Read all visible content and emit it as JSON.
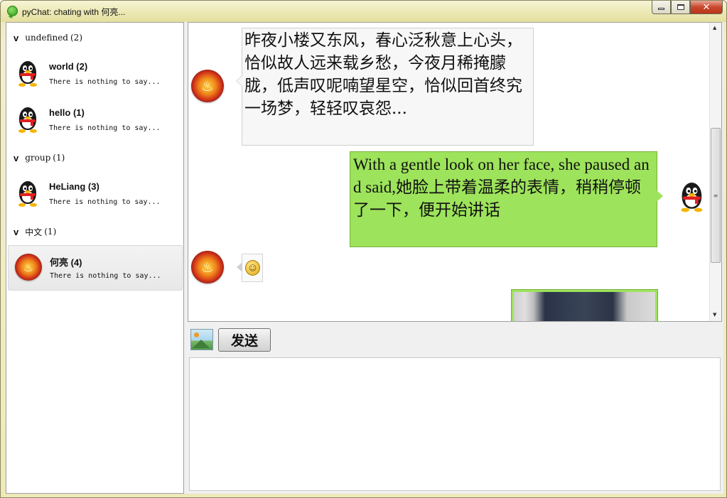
{
  "window": {
    "title": "pyChat: chating with 何亮..."
  },
  "contacts": {
    "groups": [
      {
        "name": "undefined",
        "count": "(2)",
        "members": [
          {
            "name": "world (2)",
            "status": "There is nothing to say...",
            "avatar": "penguin-icon"
          },
          {
            "name": "hello (1)",
            "status": "There is nothing to say...",
            "avatar": "penguin-icon"
          }
        ]
      },
      {
        "name": "group",
        "count": "(1)",
        "members": [
          {
            "name": "HeLiang (3)",
            "status": "There is nothing to say...",
            "avatar": "penguin-icon"
          }
        ]
      },
      {
        "name": "中文",
        "count": "(1)",
        "members": [
          {
            "name": "何亮 (4)",
            "status": "There is nothing to say...",
            "avatar": "fire-avatar-icon",
            "selected": true
          }
        ]
      }
    ]
  },
  "chat": {
    "messages": [
      {
        "side": "left",
        "avatar": "fire-avatar-icon",
        "type": "text",
        "text": "昨夜小楼又东风，春心泛秋意上心头，恰似故人远来载乡愁，今夜月稀掩朦胧，低声叹呢喃望星空，恰似回首终究一场梦，轻轻叹哀怨..."
      },
      {
        "side": "right",
        "avatar": "penguin-icon",
        "type": "text",
        "text": "With a gentle look on her face, she paused and said,她脸上带着温柔的表情，稍稍停顿了一下，便开始讲话"
      },
      {
        "side": "left",
        "avatar": "fire-avatar-icon",
        "type": "emoji",
        "emoji": "smiley-emoji-icon"
      },
      {
        "side": "right",
        "type": "image",
        "image": "photo-thumbnail"
      }
    ],
    "colors": {
      "sent_bubble": "#9de35b",
      "received_bubble": "#f7f7f7"
    }
  },
  "toolbar": {
    "image_icon": "image-icon",
    "send_label": "发送"
  },
  "input": {
    "value": ""
  }
}
